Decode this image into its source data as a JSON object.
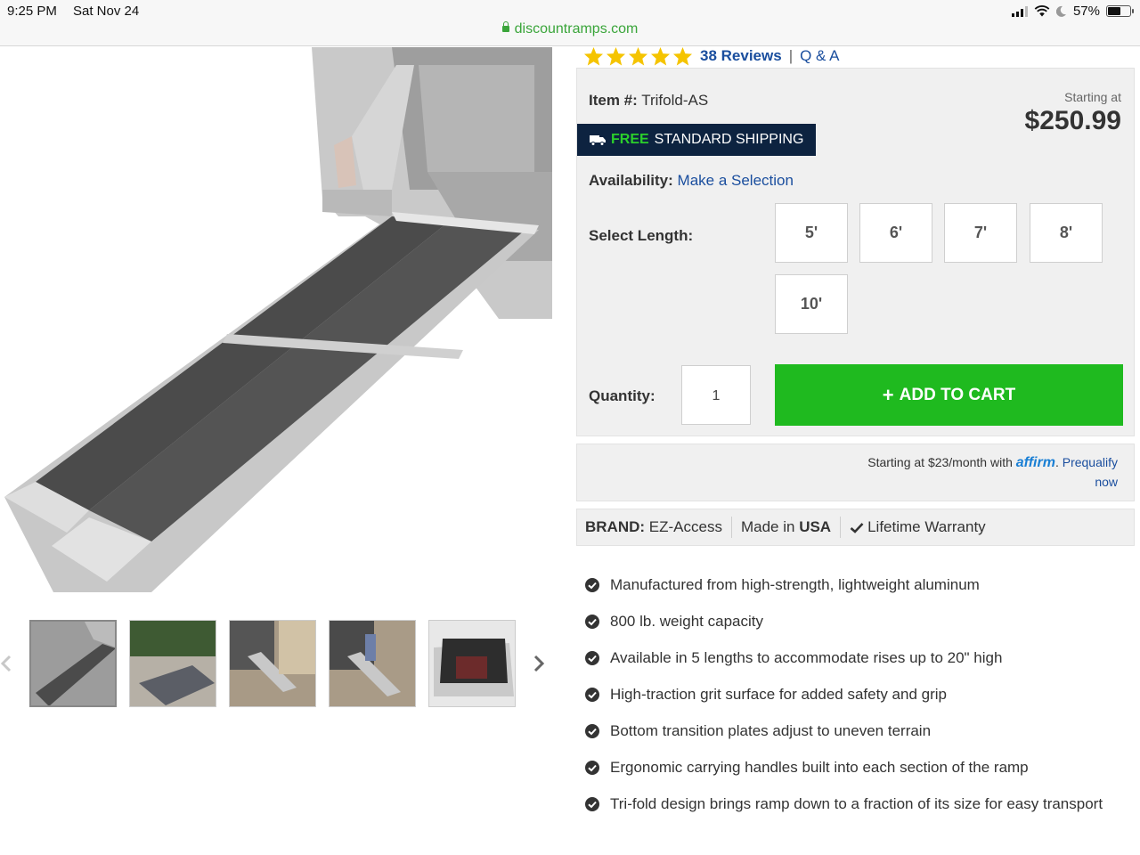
{
  "status_bar": {
    "time": "9:25 PM",
    "date": "Sat Nov 24",
    "battery": "57%",
    "url": "discountramps.com"
  },
  "product": {
    "rating_stars": 5,
    "reviews_label": "38 Reviews",
    "qa_label": "Q & A",
    "item_label": "Item #:",
    "item_number": "Trifold-AS",
    "starting_at_label": "Starting at",
    "price": "$250.99",
    "shipping_free": "FREE",
    "shipping_rest": "STANDARD SHIPPING",
    "availability_label": "Availability:",
    "availability_value": "Make a Selection",
    "select_length_label": "Select Length:",
    "lengths": [
      "5'",
      "6'",
      "7'",
      "8'",
      "10'"
    ],
    "quantity_label": "Quantity:",
    "quantity_value": "1",
    "add_to_cart": "ADD TO CART"
  },
  "financing": {
    "text": "Starting at $23/month with",
    "brand": "affirm",
    "link_part1": "Prequalify",
    "link_part2": "now"
  },
  "brand_bar": {
    "brand_label": "BRAND:",
    "brand_value": "EZ-Access",
    "made_in_label": "Made in",
    "made_in_value": "USA",
    "warranty": "Lifetime Warranty"
  },
  "features": [
    "Manufactured from high-strength, lightweight aluminum",
    "800 lb. weight capacity",
    "Available in 5 lengths to accommodate rises up to 20\" high",
    "High-traction grit surface for added safety and grip",
    "Bottom transition plates adjust to uneven terrain",
    "Ergonomic carrying handles built into each section of the ramp",
    "Tri-fold design brings ramp down to a fraction of its size for easy transport"
  ],
  "colors": {
    "link_blue": "#1a4e9e",
    "cart_green": "#1fba1f",
    "shipping_navy": "#0d2340",
    "star_yellow": "#f5c400"
  }
}
